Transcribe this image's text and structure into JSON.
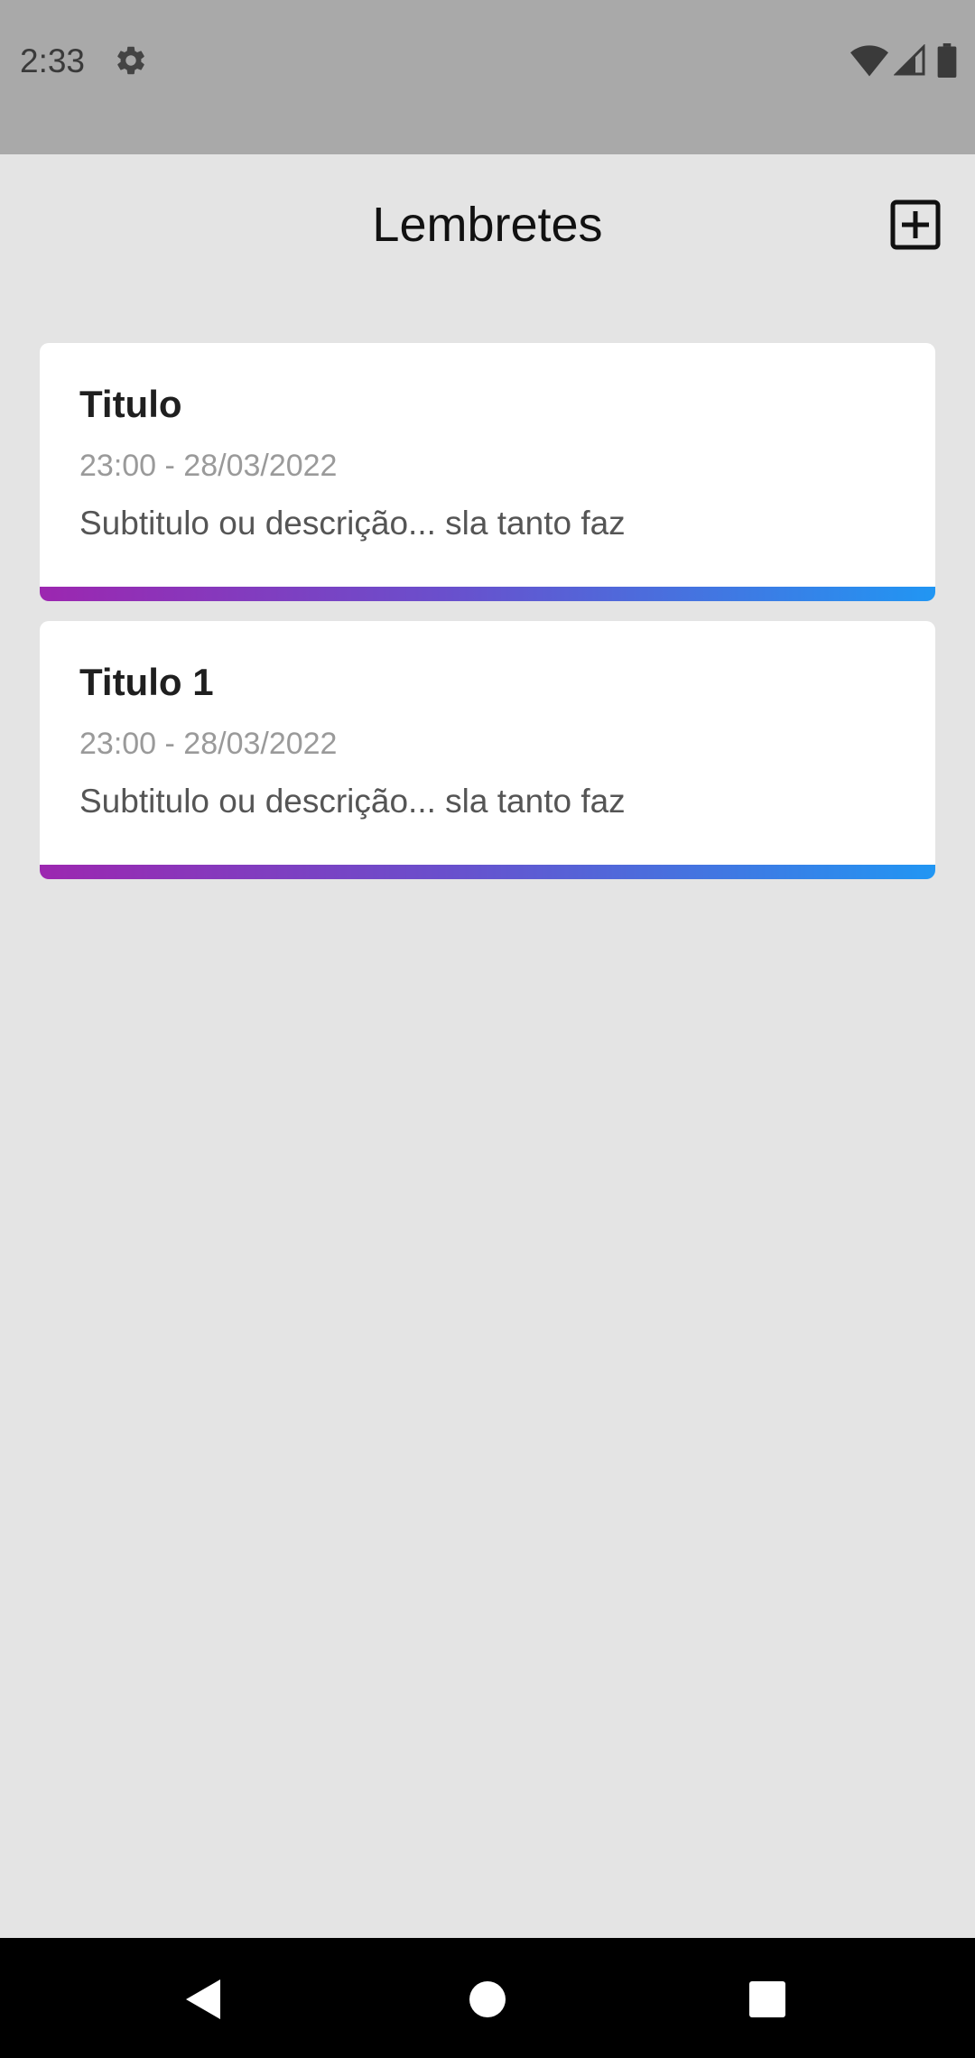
{
  "status_bar": {
    "time": "2:33",
    "icons": [
      "gear-icon",
      "wifi-icon",
      "cell-signal-icon",
      "battery-icon"
    ]
  },
  "header": {
    "title": "Lembretes",
    "add_icon": "plus-square-icon"
  },
  "reminders": [
    {
      "title": "Titulo",
      "time": "23:00 - 28/03/2022",
      "description": "Subtitulo ou descrição... sla tanto faz"
    },
    {
      "title": "Titulo 1",
      "time": "23:00 - 28/03/2022",
      "description": "Subtitulo ou descrição... sla tanto faz"
    }
  ],
  "navigation": {
    "icons": [
      "back-icon",
      "home-icon",
      "recents-icon"
    ]
  },
  "colors": {
    "background": "#e4e4e4",
    "status_bar": "#a9a9a9",
    "gradient_start": "#9c27b0",
    "gradient_end": "#2196f3"
  }
}
